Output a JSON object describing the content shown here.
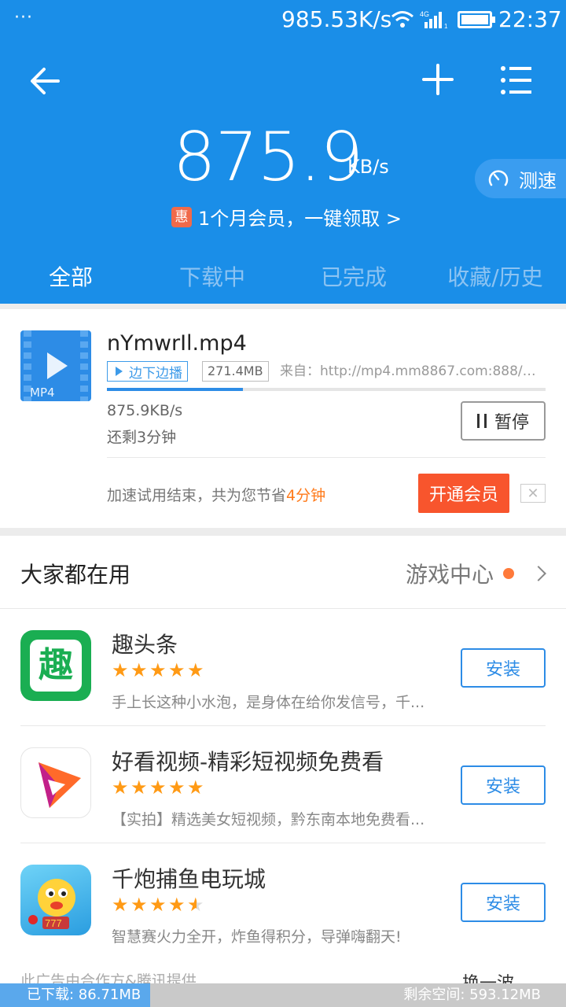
{
  "status_bar": {
    "dots": "···",
    "net_speed": "985.53K/s",
    "network_type": "4G",
    "time": "22:37"
  },
  "header": {
    "speed_value": "875.9",
    "speed_unit": "KB/s",
    "promo_badge": "惠",
    "promo_text": "1个月会员，一键领取 >",
    "speedtest_label": "测速",
    "tabs": [
      {
        "label": "全部"
      },
      {
        "label": "下载中"
      },
      {
        "label": "已完成"
      },
      {
        "label": "收藏/历史"
      }
    ]
  },
  "download": {
    "file_type": "MP4",
    "file_name": "nYmwrIl.mp4",
    "play_tag": "边下边播",
    "size": "271.4MB",
    "source": "来自：http://mp4.mm8867.com:888/ne...",
    "progress_fraction": 0.31,
    "rate": "875.9KB/s",
    "remaining": "还剩3分钟",
    "pause_label": "暂停",
    "saved_prefix": "加速试用结束，共为您节省",
    "saved_highlight": "4分钟",
    "vip_label": "开通会员",
    "close_symbol": "✕"
  },
  "apps_section": {
    "title": "大家都在用",
    "game_center": "游戏中心",
    "apps": [
      {
        "name": "趣头条",
        "rating": 5,
        "desc": "手上长这种小水泡，是身体在给你发信号，千...",
        "install": "安装",
        "icon_glyph": "趣"
      },
      {
        "name": "好看视频-精彩短视频免费看",
        "rating": 5,
        "desc": "【实拍】精选美女短视频，黔东南本地免费看...",
        "install": "安装"
      },
      {
        "name": "千炮捕鱼电玩城",
        "rating": 4.5,
        "desc": "智慧赛火力全开，炸鱼得积分，导弹嗨翻天!",
        "install": "安装"
      }
    ],
    "ad_note": "此广告由合作方&腾讯提供",
    "refresh_label": "换一波"
  },
  "bottom_bar": {
    "downloaded": "已下载: 86.71MB",
    "free_space": "剩余空间: 593.12MB"
  },
  "colors": {
    "brand_blue": "#1a8ee8",
    "accent_orange": "#f8552d",
    "star": "#ff9a15"
  }
}
